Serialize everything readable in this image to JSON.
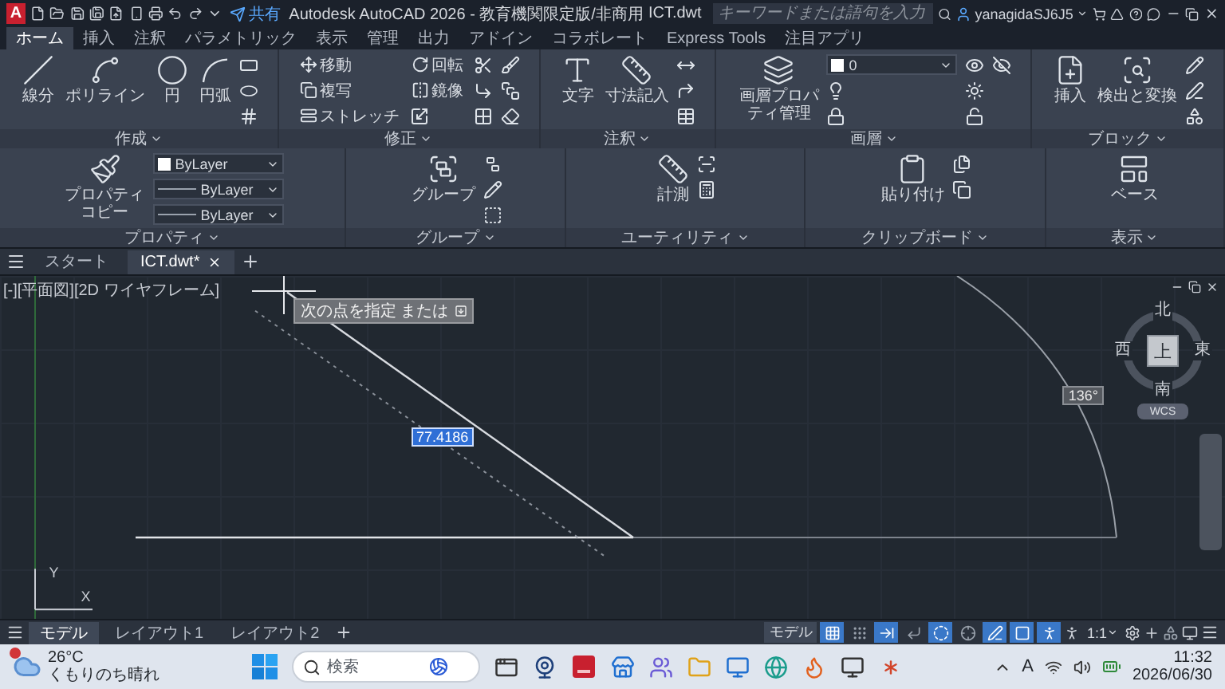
{
  "title_bar": {
    "app_button": "A",
    "share": "共有",
    "title": "Autodesk AutoCAD 2026 - 教育機関限定版/非商用",
    "file_name": "ICT.dwt",
    "search": {
      "placeholder": "キーワードまたは語句を入力"
    },
    "user": "yanagidaSJ6J5"
  },
  "ribbon_tabs": [
    {
      "label": "ホーム",
      "selected": true
    },
    {
      "label": "挿入",
      "selected": false
    },
    {
      "label": "注釈",
      "selected": false
    },
    {
      "label": "パラメトリック",
      "selected": false
    },
    {
      "label": "表示",
      "selected": false
    },
    {
      "label": "管理",
      "selected": false
    },
    {
      "label": "出力",
      "selected": false
    },
    {
      "label": "アドイン",
      "selected": false
    },
    {
      "label": "コラボレート",
      "selected": false
    },
    {
      "label": "Express Tools",
      "selected": false
    },
    {
      "label": "注目アプリ",
      "selected": false
    }
  ],
  "ribbon_panels": [
    {
      "title": "作成",
      "tools": [
        {
          "kind": "large",
          "label": "線分"
        },
        {
          "kind": "large",
          "label": "ポリライン"
        },
        {
          "kind": "large",
          "label": "円"
        },
        {
          "kind": "large",
          "label": "円弧"
        },
        {
          "kind": "icon"
        },
        {
          "kind": "icon"
        },
        {
          "kind": "icon"
        }
      ]
    },
    {
      "title": "修正",
      "tools": [
        {
          "kind": "small",
          "label": "移動"
        },
        {
          "kind": "small",
          "label": "複写"
        },
        {
          "kind": "small",
          "label": "ストレッチ"
        },
        {
          "kind": "small",
          "label": "回転"
        },
        {
          "kind": "small",
          "label": "鏡像"
        },
        {
          "kind": "icon"
        },
        {
          "kind": "icon"
        },
        {
          "kind": "icon"
        },
        {
          "kind": "icon"
        },
        {
          "kind": "icon"
        },
        {
          "kind": "icon"
        },
        {
          "kind": "icon"
        }
      ]
    },
    {
      "title": "注釈",
      "tools": [
        {
          "kind": "large",
          "label": "文字"
        },
        {
          "kind": "large",
          "label": "寸法記入"
        },
        {
          "kind": "icon"
        },
        {
          "kind": "icon"
        },
        {
          "kind": "icon"
        }
      ]
    },
    {
      "title": "画層",
      "tools": [
        {
          "kind": "large",
          "label": "画層プロパティ管理"
        },
        {
          "kind": "swatch",
          "value": "0"
        },
        {
          "kind": "icon"
        },
        {
          "kind": "icon"
        },
        {
          "kind": "icon"
        },
        {
          "kind": "icon"
        },
        {
          "kind": "icon"
        },
        {
          "kind": "icon"
        }
      ]
    },
    {
      "title": "ブロック",
      "tools": [
        {
          "kind": "large",
          "label": "挿入"
        },
        {
          "kind": "large",
          "label": "検出と変換"
        },
        {
          "kind": "icon"
        },
        {
          "kind": "icon"
        },
        {
          "kind": "icon"
        }
      ]
    },
    {
      "title": "プロパティ",
      "tools": [
        {
          "kind": "large",
          "label": "プロパティコピー"
        },
        {
          "kind": "swatch",
          "value": "ByLayer"
        },
        {
          "kind": "linetype",
          "value": "ByLayer"
        },
        {
          "kind": "linetype",
          "value": "ByLayer"
        }
      ]
    },
    {
      "title": "グループ",
      "tools": [
        {
          "kind": "large",
          "label": "グループ"
        },
        {
          "kind": "icon"
        },
        {
          "kind": "icon"
        },
        {
          "kind": "icon"
        }
      ]
    },
    {
      "title": "ユーティリティ",
      "tools": [
        {
          "kind": "large",
          "label": "計測"
        },
        {
          "kind": "icon"
        },
        {
          "kind": "icon"
        }
      ]
    },
    {
      "title": "クリップボード",
      "tools": [
        {
          "kind": "large",
          "label": "貼り付け"
        },
        {
          "kind": "icon"
        },
        {
          "kind": "icon"
        }
      ]
    },
    {
      "title": "表示",
      "tools": [
        {
          "kind": "large",
          "label": "ベース"
        }
      ]
    }
  ],
  "document_tabs": [
    {
      "label": "スタート",
      "selected": false
    },
    {
      "label": "ICT.dwt*",
      "selected": true
    }
  ],
  "canvas": {
    "viewport_label": "[-][平面図][2D ワイヤフレーム]",
    "prompt": "次の点を指定 または",
    "length_input": "77.4186",
    "angle": "136°",
    "viewcube": {
      "top": "上",
      "north": "北",
      "east": "東",
      "south": "南",
      "west": "西",
      "ucs": "WCS"
    },
    "ucs_icon": {
      "x": "X",
      "y": "Y"
    }
  },
  "layout_tabs": [
    {
      "label": "モデル",
      "selected": true
    },
    {
      "label": "レイアウト1",
      "selected": false
    },
    {
      "label": "レイアウト2",
      "selected": false
    }
  ],
  "status_bar": {
    "space": "モデル",
    "scale": "1:1",
    "toggles": [
      {
        "on": true
      },
      {
        "on": false
      },
      {
        "on": true
      },
      {
        "on": false
      },
      {
        "on": true
      },
      {
        "on": false
      },
      {
        "on": true
      },
      {
        "on": true
      },
      {
        "on": true
      }
    ]
  },
  "taskbar": {
    "weather": {
      "temperature": "26°C",
      "condition": "くもりのち晴れ"
    },
    "search": {
      "placeholder": "検索"
    },
    "input_indicator": "A",
    "time": "11:32",
    "date": "2026/06/30"
  }
}
